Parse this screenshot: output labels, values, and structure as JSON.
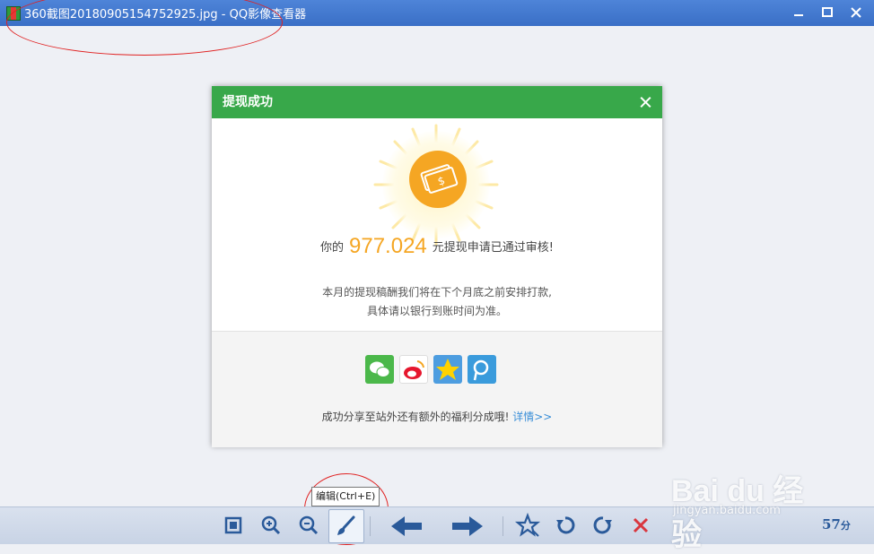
{
  "window": {
    "title": "360截图20180905154752925.jpg - QQ影像查看器",
    "controls": [
      "minimize",
      "maximize",
      "close"
    ]
  },
  "dialog": {
    "header": "提现成功",
    "amount_prefix": "你的",
    "amount": "977.024",
    "amount_suffix": "元提现申请已通过审核!",
    "info_line1": "本月的提现稿酬我们将在下个月底之前安排打款,",
    "info_line2": "具体请以银行到账时间为准。",
    "share_icons": [
      "wechat-icon",
      "weibo-icon",
      "qzone-icon",
      "tencent-weibo-icon"
    ],
    "share_text": "成功分享至站外还有额外的福利分成哦!",
    "share_link": "详情>>"
  },
  "tooltip": "编辑(Ctrl+E)",
  "toolbar": {
    "buttons": [
      "fit-icon",
      "zoom-in-icon",
      "zoom-out-icon",
      "edit-brush-icon",
      "previous-icon",
      "next-icon",
      "favorite-icon",
      "rotate-left-icon",
      "rotate-right-icon",
      "delete-icon"
    ],
    "rating_value": "57",
    "rating_unit": "分"
  },
  "watermark": {
    "brand": "Bai du 经验",
    "url": "jingyan.baidu.com"
  },
  "colors": {
    "title_bar": "#3a6fc6",
    "dialog_header": "#38a84a",
    "amount": "#f5a623",
    "link": "#3b8fd8",
    "annotation": "#e02020"
  }
}
